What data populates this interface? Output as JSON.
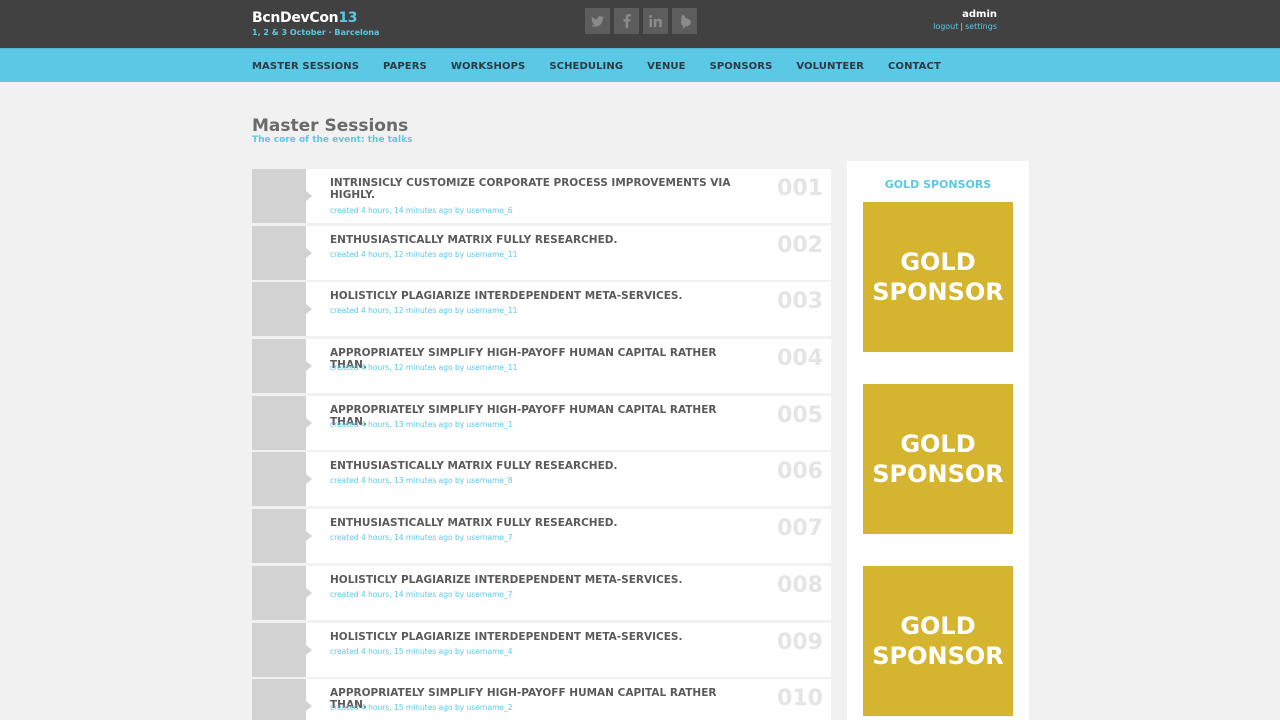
{
  "header": {
    "brand_name": "BcnDevCon",
    "brand_number": "13",
    "brand_subtitle": "1, 2 & 3 October · Barcelona",
    "social": [
      {
        "icon": "twitter-icon",
        "glyph": "t"
      },
      {
        "icon": "facebook-icon",
        "glyph": "f"
      },
      {
        "icon": "linkedin-icon",
        "glyph": "in"
      },
      {
        "icon": "bird-icon",
        "glyph": ""
      }
    ],
    "user": {
      "name": "admin",
      "logout": "logout",
      "separator": "|",
      "settings": "settings"
    }
  },
  "nav": {
    "items": [
      "MASTER SESSIONS",
      "PAPERS",
      "WORKSHOPS",
      "SCHEDULING",
      "VENUE",
      "SPONSORS",
      "VOLUNTEER",
      "CONTACT"
    ]
  },
  "main": {
    "title": "Master Sessions",
    "subtitle": "The core of the event: the talks",
    "sessions": [
      {
        "title": "INTRINSICLY CUSTOMIZE CORPORATE PROCESS IMPROVEMENTS VIA HIGHLY.",
        "meta": "created 4 hours, 14 minutes ago by username_6",
        "number": "001"
      },
      {
        "title": "ENTHUSIASTICALLY MATRIX FULLY RESEARCHED.",
        "meta": "created 4 hours, 12 minutes ago by username_11",
        "number": "002"
      },
      {
        "title": "HOLISTICLY PLAGIARIZE INTERDEPENDENT META-SERVICES.",
        "meta": "created 4 hours, 12 minutes ago by username_11",
        "number": "003"
      },
      {
        "title": "APPROPRIATELY SIMPLIFY HIGH-PAYOFF HUMAN CAPITAL RATHER THAN.",
        "meta": "created 4 hours, 12 minutes ago by username_11",
        "number": "004"
      },
      {
        "title": "APPROPRIATELY SIMPLIFY HIGH-PAYOFF HUMAN CAPITAL RATHER THAN.",
        "meta": "created 4 hours, 13 minutes ago by username_1",
        "number": "005"
      },
      {
        "title": "ENTHUSIASTICALLY MATRIX FULLY RESEARCHED.",
        "meta": "created 4 hours, 13 minutes ago by username_8",
        "number": "006"
      },
      {
        "title": "ENTHUSIASTICALLY MATRIX FULLY RESEARCHED.",
        "meta": "created 4 hours, 14 minutes ago by username_7",
        "number": "007"
      },
      {
        "title": "HOLISTICLY PLAGIARIZE INTERDEPENDENT META-SERVICES.",
        "meta": "created 4 hours, 14 minutes ago by username_7",
        "number": "008"
      },
      {
        "title": "HOLISTICLY PLAGIARIZE INTERDEPENDENT META-SERVICES.",
        "meta": "created 4 hours, 15 minutes ago by username_4",
        "number": "009"
      },
      {
        "title": "APPROPRIATELY SIMPLIFY HIGH-PAYOFF HUMAN CAPITAL RATHER THAN.",
        "meta": "created 4 hours, 15 minutes ago by username_2",
        "number": "010"
      }
    ]
  },
  "sidebar": {
    "title": "GOLD SPONSORS",
    "sponsors": [
      {
        "line1": "GOLD",
        "line2": "SPONSOR"
      },
      {
        "line1": "GOLD",
        "line2": "SPONSOR"
      },
      {
        "line1": "GOLD",
        "line2": "SPONSOR"
      }
    ]
  },
  "colors": {
    "topbar": "#414141",
    "accent": "#5bc8e6",
    "gold": "#d5b42f",
    "background": "#f1f1f1"
  }
}
